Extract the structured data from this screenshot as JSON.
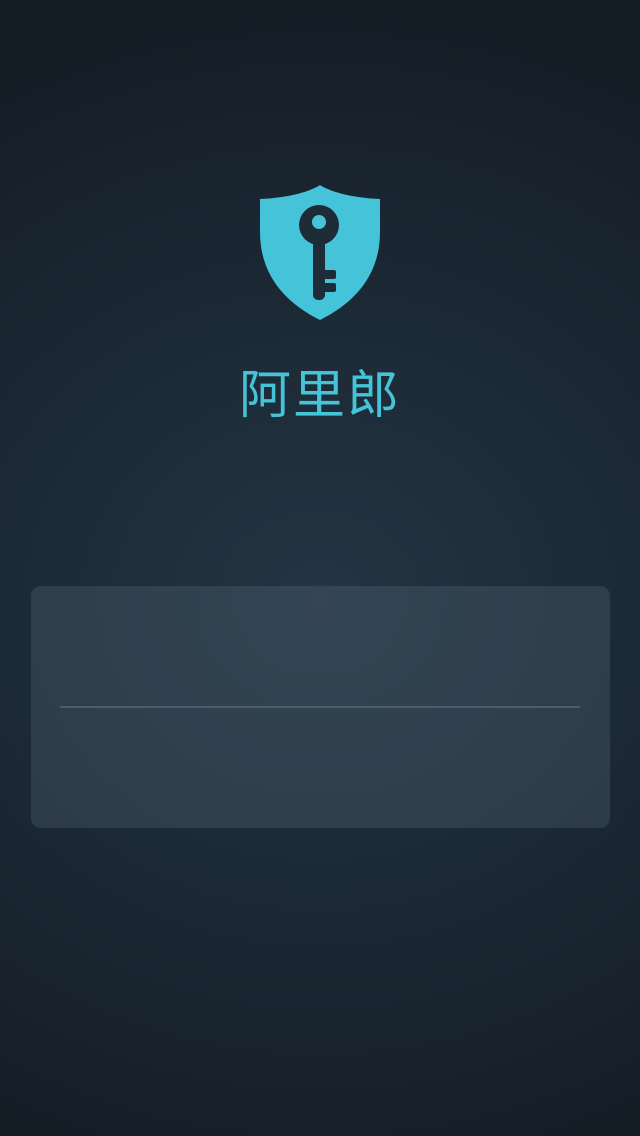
{
  "app": {
    "name": "阿里郎"
  },
  "logo": {
    "icon": "shield-key-icon",
    "color": "#45c3d9",
    "key_color": "#1e2c38"
  },
  "login": {
    "username": {
      "value": "",
      "placeholder": ""
    },
    "password": {
      "value": "",
      "placeholder": ""
    }
  },
  "colors": {
    "background": "#1c2a36",
    "accent": "#45c3d9",
    "card": "#34434e",
    "divider": "#4c5e6b"
  }
}
